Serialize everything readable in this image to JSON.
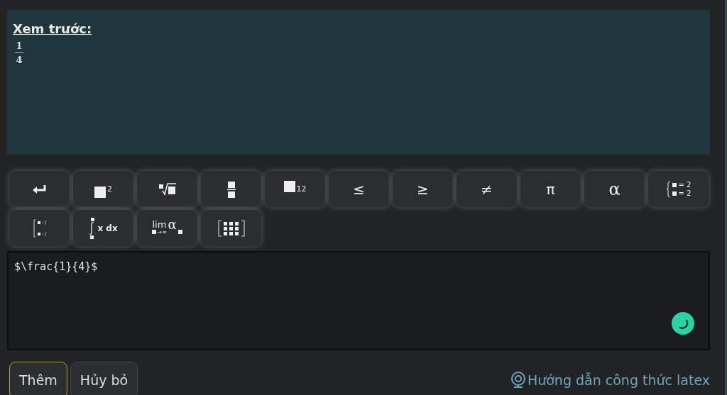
{
  "preview": {
    "heading": "Xem trước:",
    "numerator": "1",
    "denominator": "4"
  },
  "toolbar": [
    {
      "kind": "enter"
    },
    {
      "kind": "power",
      "text": "2"
    },
    {
      "kind": "root"
    },
    {
      "kind": "fraction"
    },
    {
      "kind": "subscript",
      "text": "12"
    },
    {
      "kind": "symbol",
      "text": "≤"
    },
    {
      "kind": "symbol",
      "text": "≥"
    },
    {
      "kind": "symbol",
      "text": "≠"
    },
    {
      "kind": "symbol",
      "text": "π"
    },
    {
      "kind": "greek",
      "text": "α"
    },
    {
      "kind": "system",
      "lines": [
        "= 2",
        "= 2"
      ]
    },
    {
      "kind": "cases"
    },
    {
      "kind": "integral",
      "text": "x dx"
    },
    {
      "kind": "limit",
      "text": "lim",
      "sub": "→∞",
      "greek": "α"
    },
    {
      "kind": "matrix"
    }
  ],
  "editor": {
    "value": "$\\frac{1}{4}$"
  },
  "buttons": [
    {
      "label": "Thêm",
      "selected": true
    },
    {
      "label": "Hủy bỏ",
      "selected": false
    }
  ],
  "help_link": "Hướng dẫn công thức latex"
}
